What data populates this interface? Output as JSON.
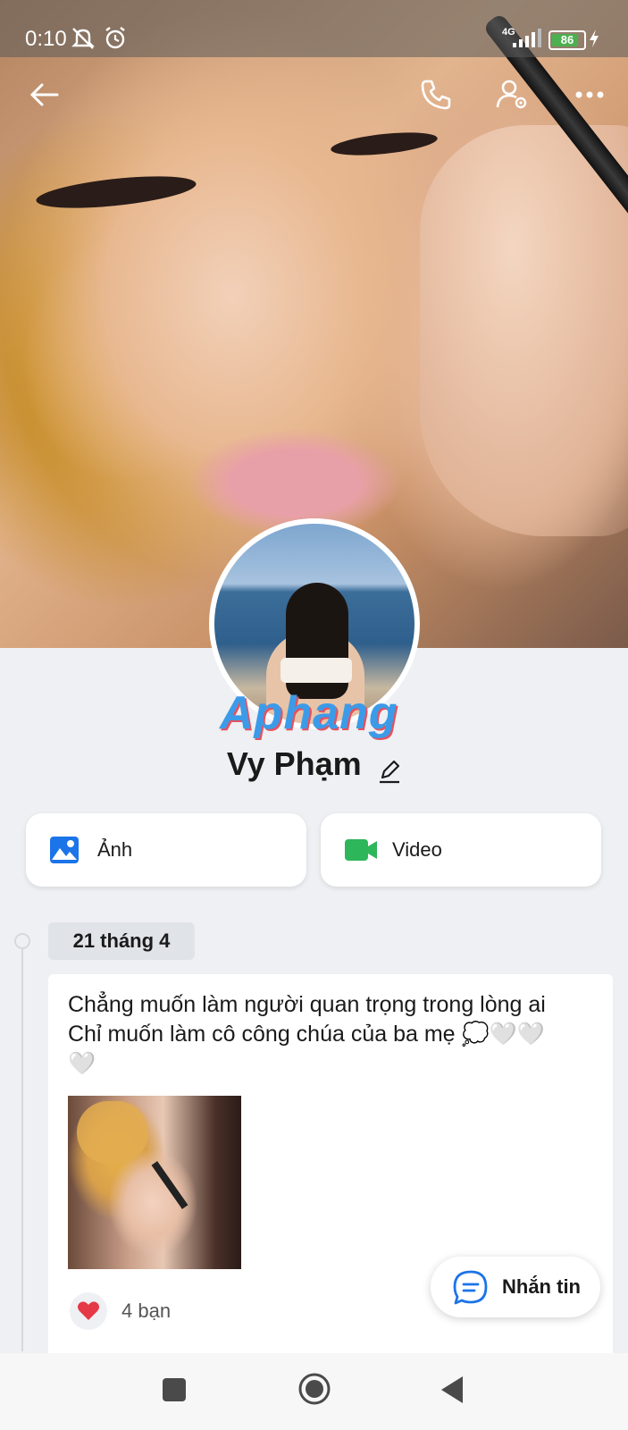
{
  "status_bar": {
    "time": "0:10",
    "network": "4G",
    "battery": "86",
    "battery_level": 0.86
  },
  "top_bar": {
    "icons": [
      "back-arrow-icon",
      "phone-icon",
      "user-settings-icon",
      "more-icon"
    ]
  },
  "profile": {
    "watermark": "Aphang",
    "name": "Vy Phạm"
  },
  "media_buttons": {
    "photo_label": "Ảnh",
    "video_label": "Video",
    "photo_color": "#1b74e8",
    "video_color": "#2eb65a"
  },
  "timeline": {
    "date": "21 tháng 4",
    "post": {
      "line1": "Chẳng muốn làm người quan trọng trong lòng ai",
      "line2": "Chỉ muốn làm cô công chúa của ba mẹ 💭🤍🤍",
      "line3": "🤍",
      "likes": "4 bạn"
    }
  },
  "chat_button": {
    "label": "Nhắn tin"
  },
  "nav_bar": {
    "icons": [
      "recents-icon",
      "home-icon",
      "back-icon"
    ]
  }
}
